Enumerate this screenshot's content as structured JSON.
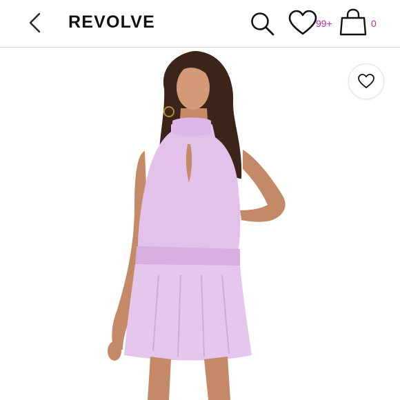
{
  "header": {
    "brand": "REVOLVE",
    "wishlist_count": "99+",
    "bag_count": "0",
    "accent_color": "#c02b9f"
  },
  "icons": {
    "back": "chevron-left-icon",
    "search": "search-icon",
    "wishlist": "heart-outline-icon",
    "bag": "shopping-bag-icon",
    "favorite": "heart-outline-icon"
  },
  "product": {
    "dress_color": "#e2c2ea"
  }
}
